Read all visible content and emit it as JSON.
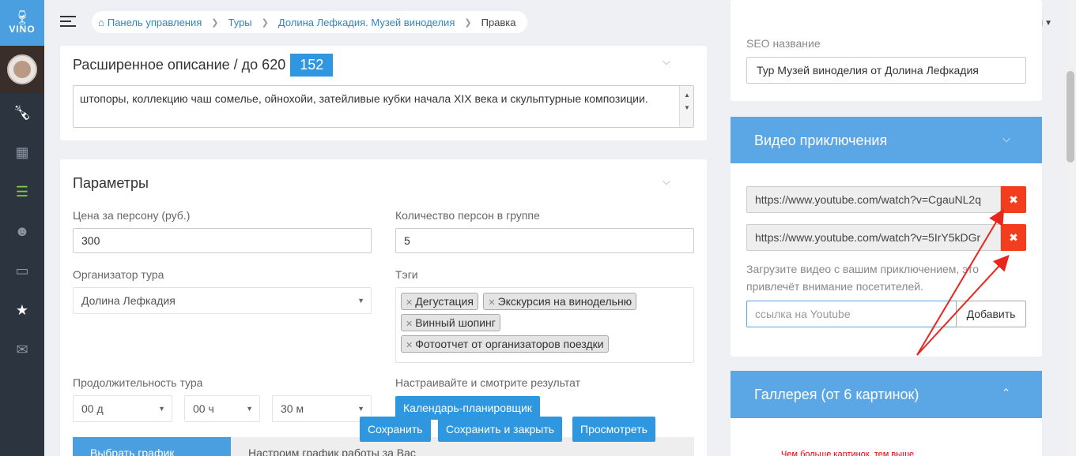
{
  "app": {
    "logo_text": "VINO"
  },
  "breadcrumb": {
    "items": [
      "Панель управления",
      "Туры",
      "Долина Лефкадия. Музей виноделия"
    ],
    "current": "Правка"
  },
  "extended_description": {
    "title": "Расширенное описание / до 620",
    "badge": "152",
    "text": "штопоры, коллекцию чаш сомелье, ойнохойи, затейливые кубки начала XIX века и скульптурные композиции."
  },
  "params": {
    "title": "Параметры",
    "price_label": "Цена за персону (руб.)",
    "price_value": "300",
    "group_label": "Количество персон в группе",
    "group_value": "5",
    "organizer_label": "Организатор тура",
    "organizer_value": "Долина Лефкадия",
    "tags_label": "Тэги",
    "tags": [
      "Дегустация",
      "Экскурсия на винодельню",
      "Винный шопинг",
      "Фотоотчет от организаторов поездки"
    ],
    "duration_label": "Продолжительность тура",
    "duration_days": "00 д",
    "duration_hours": "00 ч",
    "duration_minutes": "30 м",
    "planner_label": "Настраивайте и смотрите результат",
    "planner_button": "Календарь-планировщик",
    "tab_choose": "Выбрать график работы",
    "tab_setup": "Настроим график работы за Вас"
  },
  "actions": {
    "save": "Сохранить",
    "save_close": "Сохранить и закрыть",
    "preview": "Просмотреть"
  },
  "seo": {
    "label": "SEO название",
    "value": "Тур Музей виноделия от Долина Лефкадия"
  },
  "video": {
    "title": "Видео приключения",
    "links": [
      "https://www.youtube.com/watch?v=CgauNL2q",
      "https://www.youtube.com/watch?v=5IrY5kDGr"
    ],
    "hint": "Загрузите видео с вашим приключением, это привлечёт внимание посетителей.",
    "input_placeholder": "ссылка на Youtube",
    "add_button": "Добавить"
  },
  "gallery": {
    "title": "Галлерея (от 6 картинок)",
    "note": "Чем больше картинок, тем выше"
  },
  "colors": {
    "accent": "#2f97e0",
    "danger": "#f23d1e",
    "sidebar": "#2c3440",
    "annotation": "#e8261e"
  }
}
